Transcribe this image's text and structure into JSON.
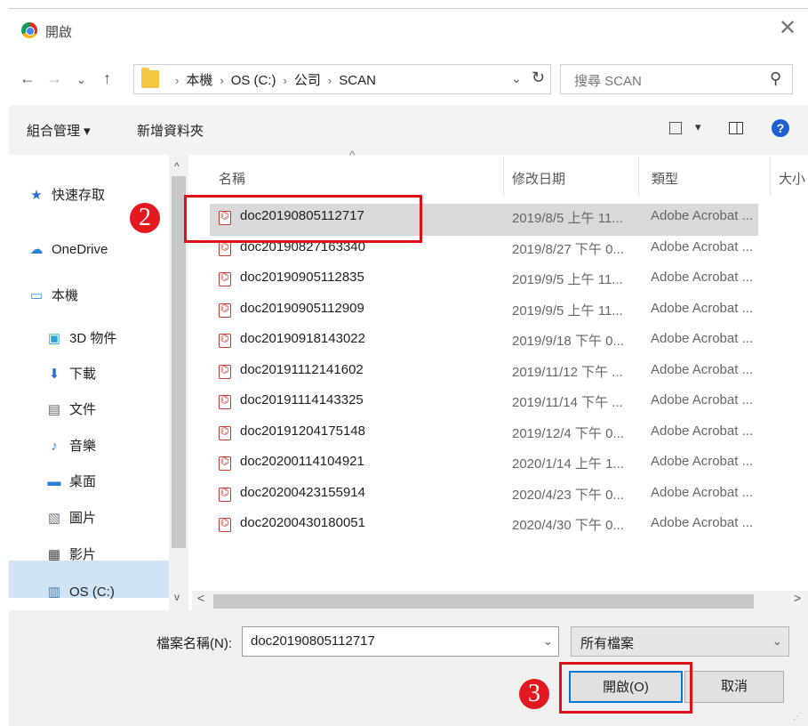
{
  "dialog": {
    "title": "開啟",
    "close_glyph": "✕"
  },
  "nav": {
    "back": "←",
    "forward": "→",
    "recent": "⌄",
    "up": "↑",
    "breadcrumb": [
      "本機",
      "OS (C:)",
      "公司",
      "SCAN"
    ],
    "breadcrumb_sep": "›",
    "dropdown": "⌄",
    "refresh": "↻",
    "search_placeholder": "搜尋 SCAN",
    "search_icon": "⚲"
  },
  "toolbar": {
    "organize_label": "組合管理 ▾",
    "new_folder_label": "新增資料夾",
    "view_dropdown": "▾",
    "help_label": "?"
  },
  "sidebar": {
    "items": [
      {
        "label": "快速存取",
        "icon": "★",
        "color": "#2a6fcf"
      },
      {
        "label": "OneDrive",
        "icon": "☁",
        "color": "#2a7fd6"
      },
      {
        "label": "本機",
        "icon": "▭",
        "color": "#2b8ad6"
      },
      {
        "label": "3D 物件",
        "icon": "▣",
        "color": "#2aa1d6"
      },
      {
        "label": "下載",
        "icon": "⬇",
        "color": "#2a6fcf"
      },
      {
        "label": "文件",
        "icon": "▤",
        "color": "#666666"
      },
      {
        "label": "音樂",
        "icon": "♪",
        "color": "#2a7fd6"
      },
      {
        "label": "桌面",
        "icon": "▬",
        "color": "#2a7fd6"
      },
      {
        "label": "圖片",
        "icon": "▧",
        "color": "#6f7a85"
      },
      {
        "label": "影片",
        "icon": "▦",
        "color": "#444444"
      },
      {
        "label": "OS (C:)",
        "icon": "▥",
        "color": "#4a7fb0"
      }
    ],
    "scroll_up": "^",
    "scroll_down": "v"
  },
  "files": {
    "columns": [
      "名稱",
      "修改日期",
      "類型",
      "大小"
    ],
    "sort_arrow": "^",
    "rows": [
      {
        "name": "doc20190805112717",
        "date": "2019/8/5 上午 11...",
        "type": "Adobe Acrobat ..."
      },
      {
        "name": "doc20190827163340",
        "date": "2019/8/27 下午 0...",
        "type": "Adobe Acrobat ..."
      },
      {
        "name": "doc20190905112835",
        "date": "2019/9/5 上午 11...",
        "type": "Adobe Acrobat ..."
      },
      {
        "name": "doc20190905112909",
        "date": "2019/9/5 上午 11...",
        "type": "Adobe Acrobat ..."
      },
      {
        "name": "doc20190918143022",
        "date": "2019/9/18 下午 0...",
        "type": "Adobe Acrobat ..."
      },
      {
        "name": "doc20191112141602",
        "date": "2019/11/12 下午 ...",
        "type": "Adobe Acrobat ..."
      },
      {
        "name": "doc20191114143325",
        "date": "2019/11/14 下午 ...",
        "type": "Adobe Acrobat ..."
      },
      {
        "name": "doc20191204175148",
        "date": "2019/12/4 下午 0...",
        "type": "Adobe Acrobat ..."
      },
      {
        "name": "doc20200114104921",
        "date": "2020/1/14 上午 1...",
        "type": "Adobe Acrobat ..."
      },
      {
        "name": "doc20200423155914",
        "date": "2020/4/23 下午 0...",
        "type": "Adobe Acrobat ..."
      },
      {
        "name": "doc20200430180051",
        "date": "2020/4/30 下午 0...",
        "type": "Adobe Acrobat ..."
      }
    ],
    "hscroll_left": "<",
    "hscroll_right": ">"
  },
  "footer": {
    "filename_label": "檔案名稱(N):",
    "filename_value": "doc20190805112717",
    "filetype_value": "所有檔案",
    "dropdown": "⌄",
    "open_label": "開啟(O)",
    "cancel_label": "取消"
  },
  "annotations": {
    "step2": "2",
    "step3": "3",
    "color": "#e0101a"
  }
}
